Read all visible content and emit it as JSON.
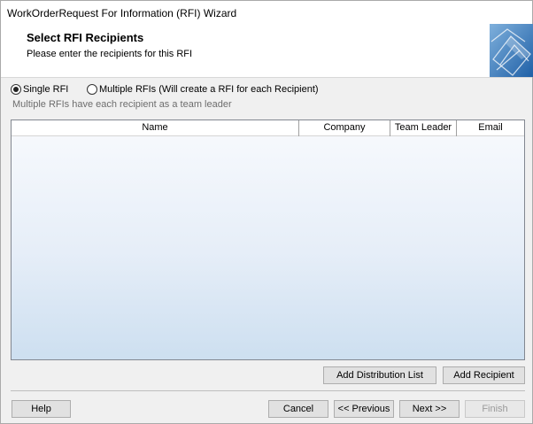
{
  "window": {
    "title": "WorkOrderRequest For Information (RFI) Wizard"
  },
  "header": {
    "title": "Select RFI Recipients",
    "subtitle": "Please enter the recipients for this RFI"
  },
  "mode": {
    "options": [
      {
        "label": "Single RFI",
        "checked": true
      },
      {
        "label": "Multiple RFIs (Will create a RFI for each Recipient)",
        "checked": false
      }
    ],
    "hint": "Multiple RFIs have each recipient as a team leader"
  },
  "recipients_grid": {
    "columns": [
      "Name",
      "Company",
      "Team Leader",
      "Email"
    ],
    "rows": []
  },
  "actions": {
    "add_distribution_list": "Add Distribution List",
    "add_recipient": "Add Recipient"
  },
  "footer": {
    "help": "Help",
    "cancel": "Cancel",
    "previous": "<< Previous",
    "next": "Next >>",
    "finish": "Finish"
  }
}
